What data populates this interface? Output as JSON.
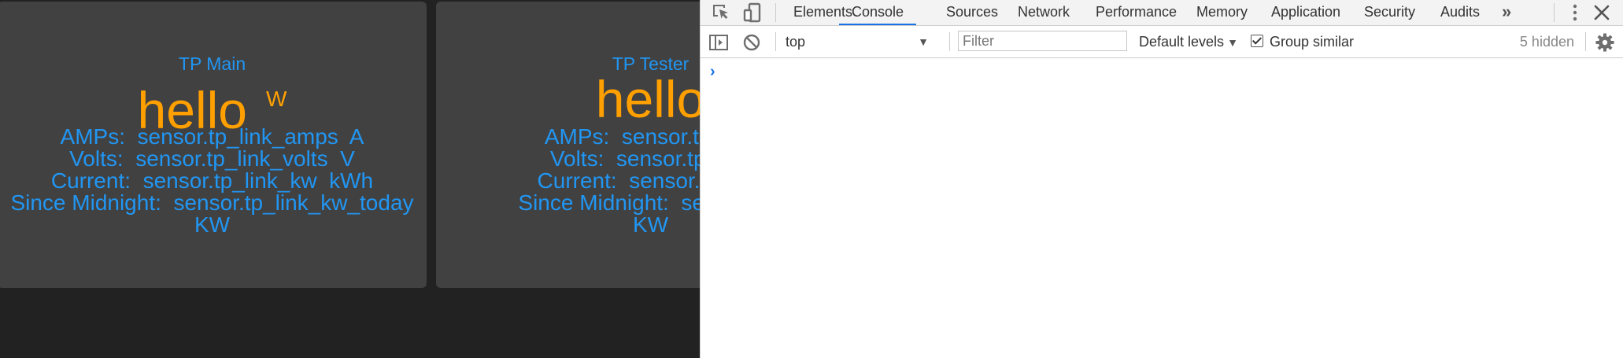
{
  "cards": [
    {
      "title": "TP Main",
      "hello": "hello",
      "hello_unit": "W",
      "lines": [
        "AMPs:  sensor.tp_link_amps  A",
        "Volts:  sensor.tp_link_volts  V",
        "Current:  sensor.tp_link_kw  kWh",
        "Since Midnight:  sensor.tp_link_kw_today",
        "KW"
      ]
    },
    {
      "title": "TP Tester",
      "hello": "hello",
      "lines": [
        "AMPs:  sensor.tp_link",
        "Volts:  sensor.tp_link",
        "Current:  sensor.tp_link",
        "Since Midnight:  sensor.tp_",
        "KW"
      ]
    }
  ],
  "devtools": {
    "tabs": [
      "Elements",
      "Console",
      "Sources",
      "Network",
      "Performance",
      "Memory",
      "Application",
      "Security",
      "Audits"
    ],
    "active_tab": "Console",
    "overflow": "»",
    "context": "top",
    "filter_placeholder": "Filter",
    "levels": "Default levels",
    "group_similar": "Group similar",
    "group_similar_checked": true,
    "hidden_count": "5 hidden",
    "prompt": "›"
  },
  "colors": {
    "card_text": "#2196f3",
    "hello_text": "#ffa000",
    "card_bg": "#414141",
    "active_tab_underline": "#1a73e8"
  }
}
